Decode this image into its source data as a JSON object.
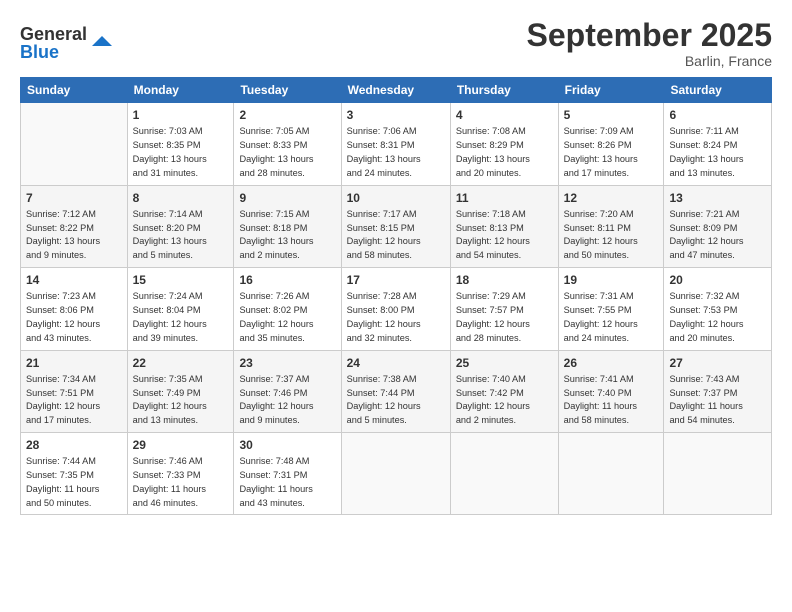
{
  "header": {
    "logo_line1": "General",
    "logo_line2": "Blue",
    "month": "September 2025",
    "location": "Barlin, France"
  },
  "days_of_week": [
    "Sunday",
    "Monday",
    "Tuesday",
    "Wednesday",
    "Thursday",
    "Friday",
    "Saturday"
  ],
  "weeks": [
    [
      {
        "day": "",
        "info": ""
      },
      {
        "day": "1",
        "info": "Sunrise: 7:03 AM\nSunset: 8:35 PM\nDaylight: 13 hours\nand 31 minutes."
      },
      {
        "day": "2",
        "info": "Sunrise: 7:05 AM\nSunset: 8:33 PM\nDaylight: 13 hours\nand 28 minutes."
      },
      {
        "day": "3",
        "info": "Sunrise: 7:06 AM\nSunset: 8:31 PM\nDaylight: 13 hours\nand 24 minutes."
      },
      {
        "day": "4",
        "info": "Sunrise: 7:08 AM\nSunset: 8:29 PM\nDaylight: 13 hours\nand 20 minutes."
      },
      {
        "day": "5",
        "info": "Sunrise: 7:09 AM\nSunset: 8:26 PM\nDaylight: 13 hours\nand 17 minutes."
      },
      {
        "day": "6",
        "info": "Sunrise: 7:11 AM\nSunset: 8:24 PM\nDaylight: 13 hours\nand 13 minutes."
      }
    ],
    [
      {
        "day": "7",
        "info": "Sunrise: 7:12 AM\nSunset: 8:22 PM\nDaylight: 13 hours\nand 9 minutes."
      },
      {
        "day": "8",
        "info": "Sunrise: 7:14 AM\nSunset: 8:20 PM\nDaylight: 13 hours\nand 5 minutes."
      },
      {
        "day": "9",
        "info": "Sunrise: 7:15 AM\nSunset: 8:18 PM\nDaylight: 13 hours\nand 2 minutes."
      },
      {
        "day": "10",
        "info": "Sunrise: 7:17 AM\nSunset: 8:15 PM\nDaylight: 12 hours\nand 58 minutes."
      },
      {
        "day": "11",
        "info": "Sunrise: 7:18 AM\nSunset: 8:13 PM\nDaylight: 12 hours\nand 54 minutes."
      },
      {
        "day": "12",
        "info": "Sunrise: 7:20 AM\nSunset: 8:11 PM\nDaylight: 12 hours\nand 50 minutes."
      },
      {
        "day": "13",
        "info": "Sunrise: 7:21 AM\nSunset: 8:09 PM\nDaylight: 12 hours\nand 47 minutes."
      }
    ],
    [
      {
        "day": "14",
        "info": "Sunrise: 7:23 AM\nSunset: 8:06 PM\nDaylight: 12 hours\nand 43 minutes."
      },
      {
        "day": "15",
        "info": "Sunrise: 7:24 AM\nSunset: 8:04 PM\nDaylight: 12 hours\nand 39 minutes."
      },
      {
        "day": "16",
        "info": "Sunrise: 7:26 AM\nSunset: 8:02 PM\nDaylight: 12 hours\nand 35 minutes."
      },
      {
        "day": "17",
        "info": "Sunrise: 7:28 AM\nSunset: 8:00 PM\nDaylight: 12 hours\nand 32 minutes."
      },
      {
        "day": "18",
        "info": "Sunrise: 7:29 AM\nSunset: 7:57 PM\nDaylight: 12 hours\nand 28 minutes."
      },
      {
        "day": "19",
        "info": "Sunrise: 7:31 AM\nSunset: 7:55 PM\nDaylight: 12 hours\nand 24 minutes."
      },
      {
        "day": "20",
        "info": "Sunrise: 7:32 AM\nSunset: 7:53 PM\nDaylight: 12 hours\nand 20 minutes."
      }
    ],
    [
      {
        "day": "21",
        "info": "Sunrise: 7:34 AM\nSunset: 7:51 PM\nDaylight: 12 hours\nand 17 minutes."
      },
      {
        "day": "22",
        "info": "Sunrise: 7:35 AM\nSunset: 7:49 PM\nDaylight: 12 hours\nand 13 minutes."
      },
      {
        "day": "23",
        "info": "Sunrise: 7:37 AM\nSunset: 7:46 PM\nDaylight: 12 hours\nand 9 minutes."
      },
      {
        "day": "24",
        "info": "Sunrise: 7:38 AM\nSunset: 7:44 PM\nDaylight: 12 hours\nand 5 minutes."
      },
      {
        "day": "25",
        "info": "Sunrise: 7:40 AM\nSunset: 7:42 PM\nDaylight: 12 hours\nand 2 minutes."
      },
      {
        "day": "26",
        "info": "Sunrise: 7:41 AM\nSunset: 7:40 PM\nDaylight: 11 hours\nand 58 minutes."
      },
      {
        "day": "27",
        "info": "Sunrise: 7:43 AM\nSunset: 7:37 PM\nDaylight: 11 hours\nand 54 minutes."
      }
    ],
    [
      {
        "day": "28",
        "info": "Sunrise: 7:44 AM\nSunset: 7:35 PM\nDaylight: 11 hours\nand 50 minutes."
      },
      {
        "day": "29",
        "info": "Sunrise: 7:46 AM\nSunset: 7:33 PM\nDaylight: 11 hours\nand 46 minutes."
      },
      {
        "day": "30",
        "info": "Sunrise: 7:48 AM\nSunset: 7:31 PM\nDaylight: 11 hours\nand 43 minutes."
      },
      {
        "day": "",
        "info": ""
      },
      {
        "day": "",
        "info": ""
      },
      {
        "day": "",
        "info": ""
      },
      {
        "day": "",
        "info": ""
      }
    ]
  ]
}
